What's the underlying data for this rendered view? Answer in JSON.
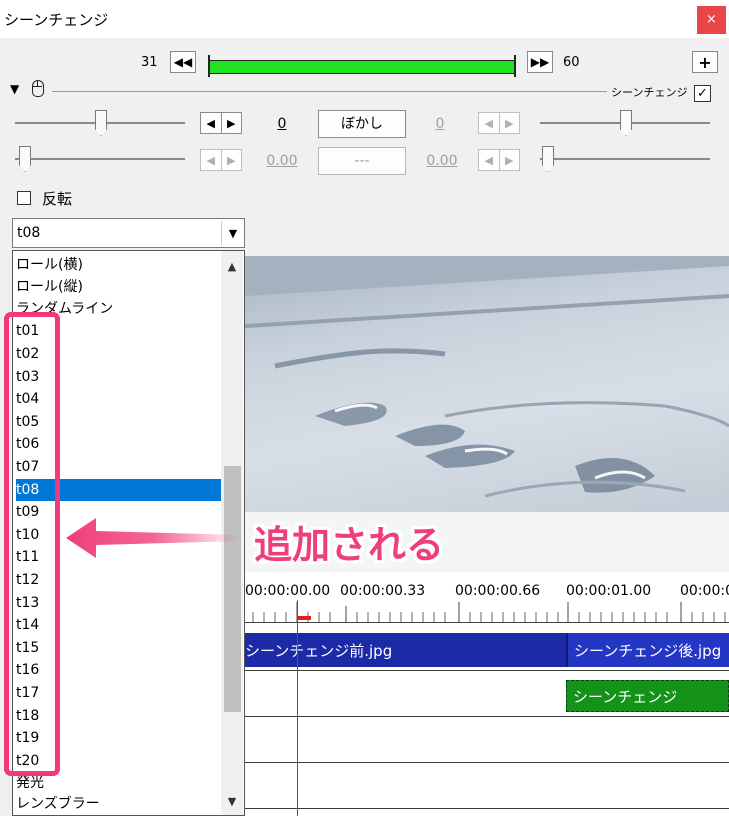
{
  "window": {
    "title": "シーンチェンジ",
    "close_label": "×"
  },
  "toolbar": {
    "frame_start": "31",
    "frame_end": "60",
    "prev_label": "◀◀",
    "next_label": "▶▶",
    "add_label": "+",
    "seek_fill_fraction": 1.0
  },
  "header": {
    "section_expand": "▼",
    "section_icon": "mouse-icon",
    "effect_name": "シーンチェンジ",
    "effect_checked": "✓"
  },
  "params": {
    "row1": {
      "left_value": "0",
      "button": "ぼかし",
      "right_value": "0"
    },
    "row2": {
      "left_value": "0.00",
      "button": "---",
      "right_value": "0.00"
    },
    "lr_left": "◀",
    "lr_right": "▶"
  },
  "invert": {
    "label": "反転",
    "checked": false
  },
  "combo": {
    "value": "t08",
    "arrow": "▼"
  },
  "list": {
    "items": [
      "ロール(横)",
      "ロール(縦)",
      "ランダムライン",
      "t01",
      "t02",
      "t03",
      "t04",
      "t05",
      "t06",
      "t07",
      "t08",
      "t09",
      "t10",
      "t11",
      "t12",
      "t13",
      "t14",
      "t15",
      "t16",
      "t17",
      "t18",
      "t19",
      "t20",
      "発光",
      "レンズブラー"
    ],
    "selected": "t08",
    "scroll_up": "▲",
    "scroll_down": "▼"
  },
  "timeline": {
    "ruler": [
      "00:00:00.00",
      "00:00:00.33",
      "00:00:00.66",
      "00:00:01.00",
      "00:00:0"
    ],
    "clip_before": "シーンチェンジ前.jpg",
    "clip_after": "シーンチェンジ後.jpg",
    "effect_clip": "シーンチェンジ"
  },
  "annotation": {
    "text": "追加される",
    "color": "#ef3f7b"
  },
  "colors": {
    "seek_fill": "#22e022",
    "selection": "#0078d7",
    "clip_blue": "#1d2aa8",
    "clip_green": "#14921a",
    "close": "#e8474a"
  }
}
